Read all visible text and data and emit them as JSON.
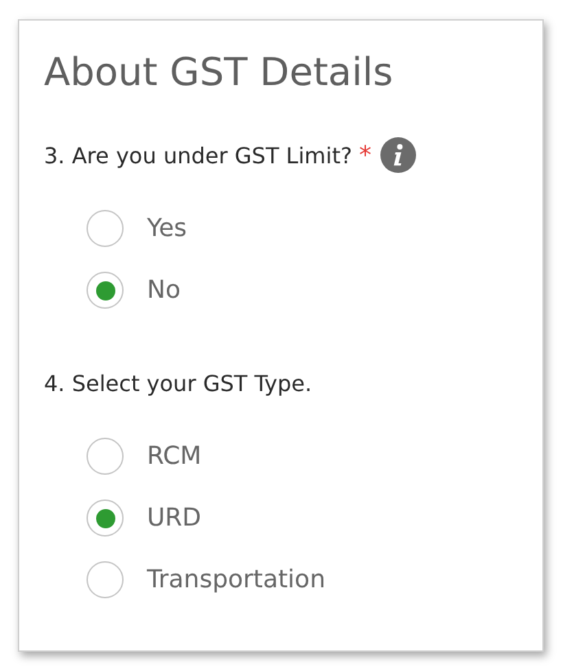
{
  "title": "About GST Details",
  "questions": [
    {
      "label": "3. Are you under GST Limit?",
      "required_mark": "*",
      "info": true,
      "options": [
        {
          "label": "Yes",
          "selected": false
        },
        {
          "label": "No",
          "selected": true
        }
      ]
    },
    {
      "label": "4. Select your GST Type.",
      "info": false,
      "options": [
        {
          "label": "RCM",
          "selected": false
        },
        {
          "label": "URD",
          "selected": true
        },
        {
          "label": "Transportation",
          "selected": false
        }
      ]
    }
  ]
}
